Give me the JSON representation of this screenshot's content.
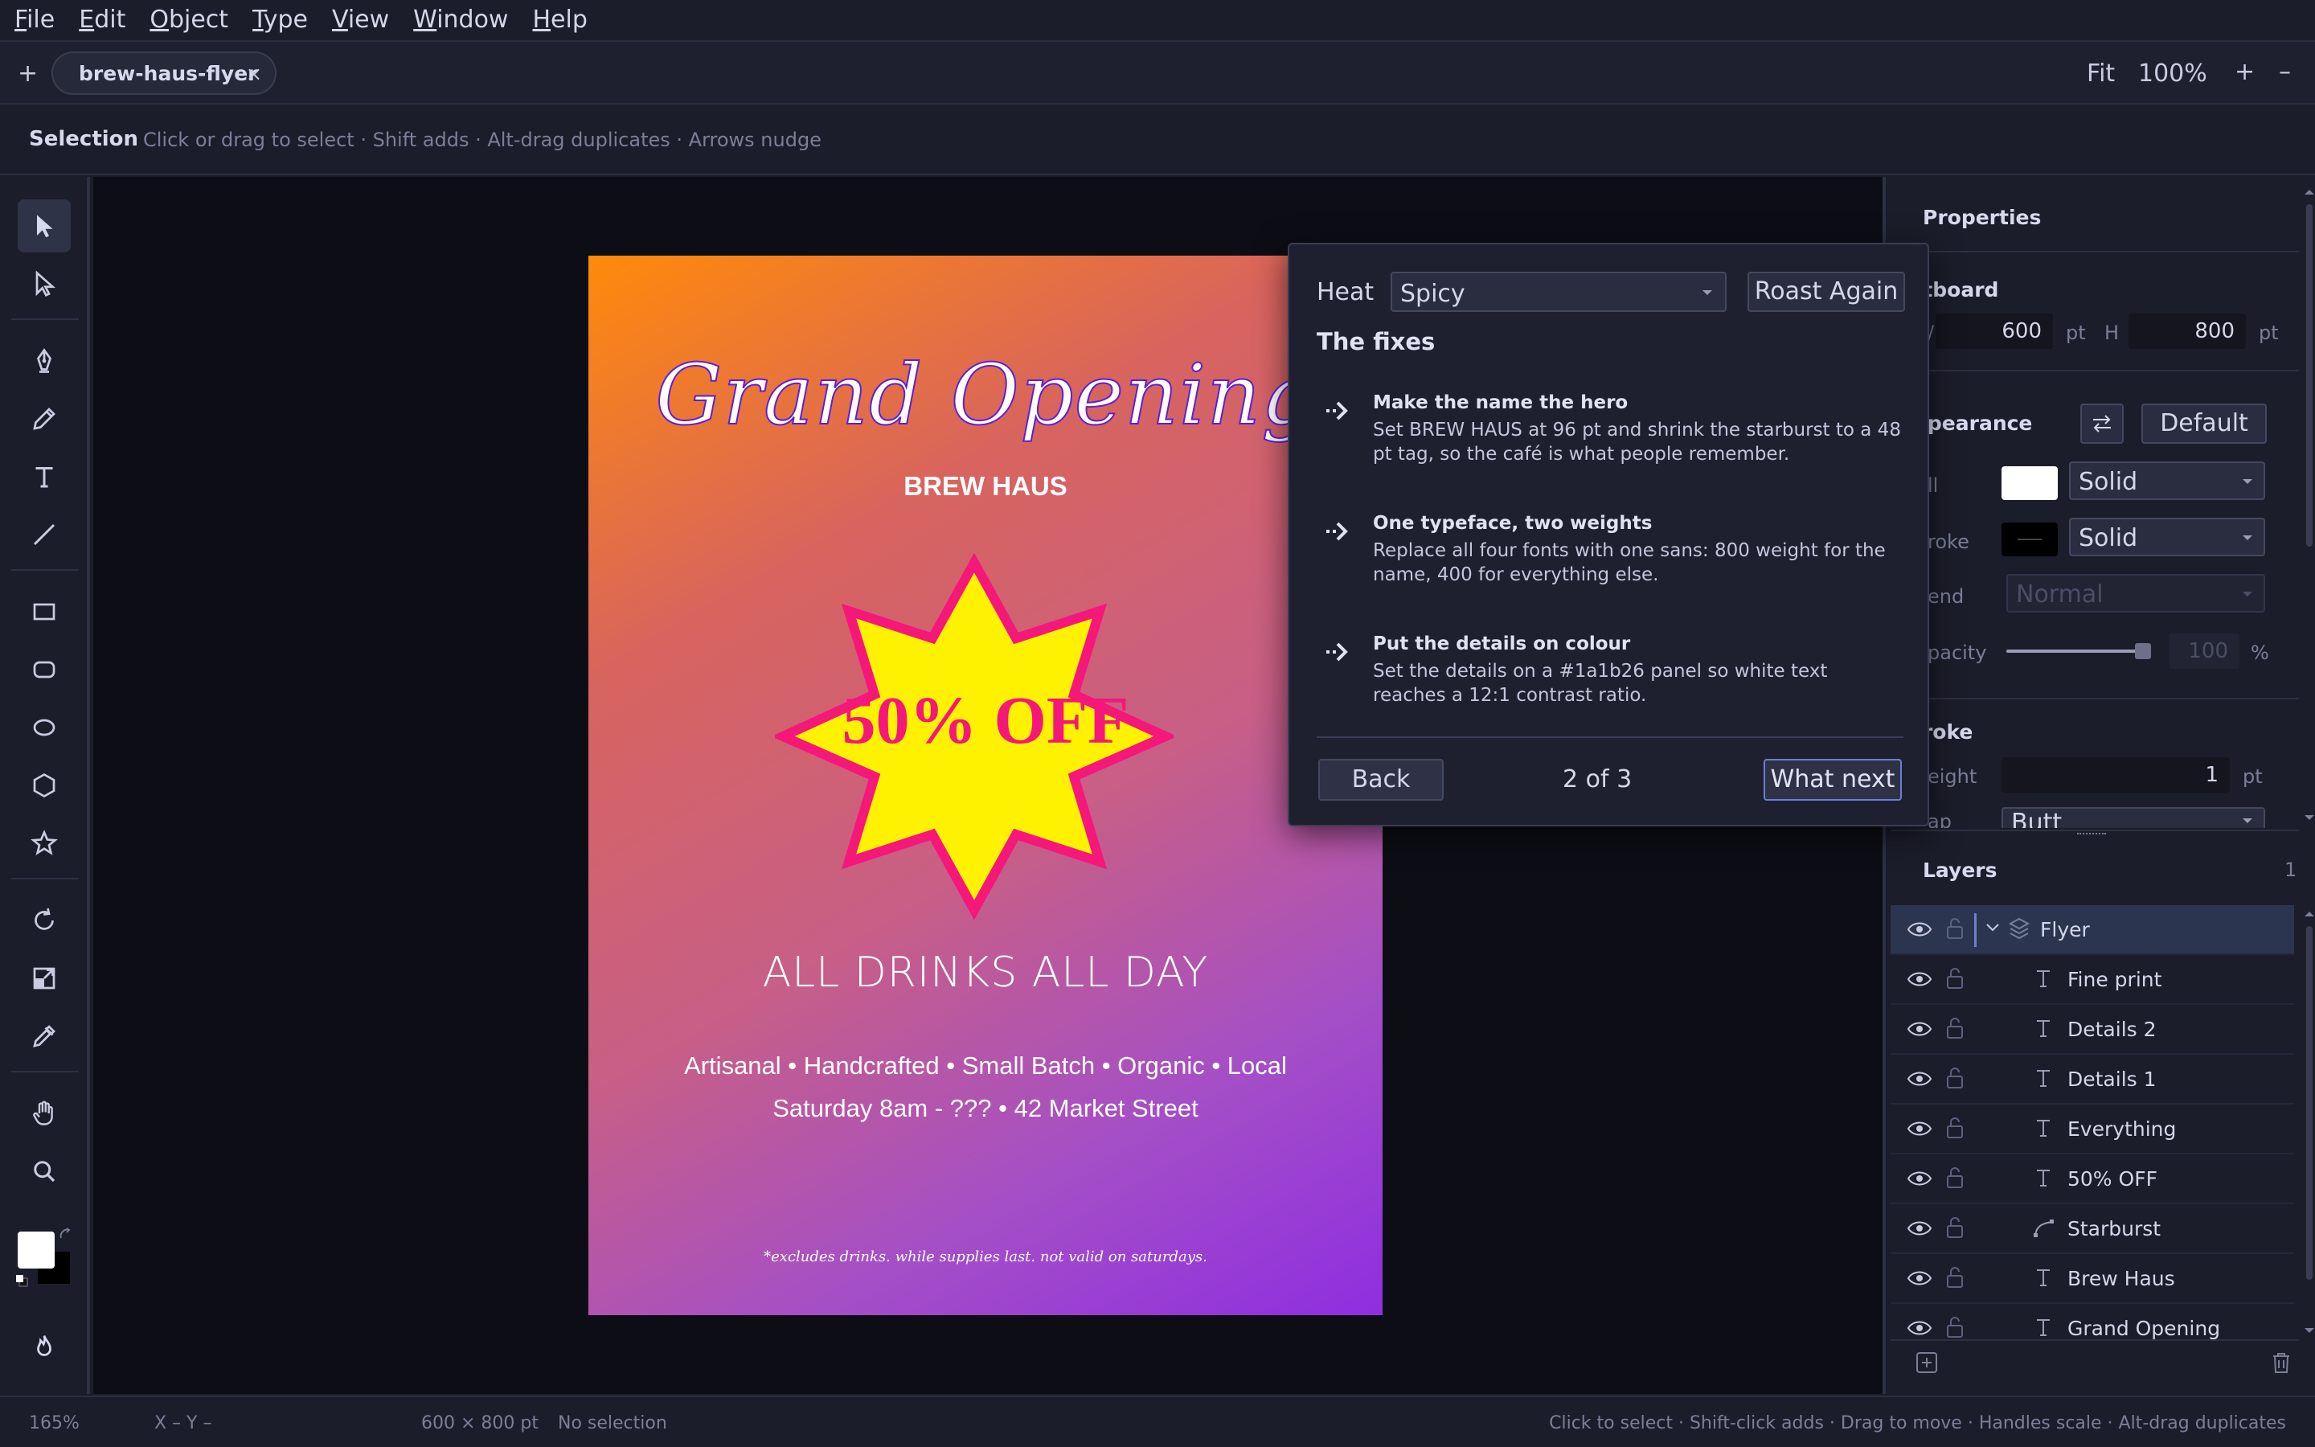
{
  "menu": [
    "File",
    "Edit",
    "Object",
    "Type",
    "View",
    "Window",
    "Help"
  ],
  "tabs": {
    "add_label": "+",
    "document": "brew-haus-flyer",
    "close_label": "×"
  },
  "zoom": {
    "fit_label": "Fit",
    "value": "100%",
    "in_label": "+",
    "out_label": "–"
  },
  "hint": {
    "tool": "Selection",
    "text": "Click or drag to select · Shift adds · Alt-drag duplicates · Arrows nudge"
  },
  "toolbar": {
    "tools": [
      "select-tool",
      "direct-select-tool",
      "pen-tool",
      "pencil-tool",
      "type-tool",
      "line-tool",
      "rectangle-tool",
      "rounded-rectangle-tool",
      "ellipse-tool",
      "polygon-tool",
      "star-tool",
      "rotate-tool",
      "scale-tool",
      "eyedropper-tool",
      "hand-tool",
      "zoom-tool",
      "roast-tool"
    ],
    "fill_color": "#ffffff",
    "stroke_color": "#000000"
  },
  "artboard": {
    "title": "Grand Opening",
    "brand": "BREW HAUS",
    "offer": "50% OFF",
    "headline": "ALL DRINKS ALL DAY",
    "details1": "Artisanal • Handcrafted • Small Batch • Organic • Local",
    "details2": "Saturday 8am - ??? • 42 Market Street",
    "fine_print": "*excludes drinks. while supplies last. not valid on saturdays.",
    "starburst_fill": "#fff200",
    "starburst_stroke": "#f5177a"
  },
  "roast": {
    "heat_label": "Heat",
    "heat_value": "Spicy",
    "roast_again": "Roast Again",
    "fixes_title": "The fixes",
    "fixes": [
      {
        "title": "Make the name the hero",
        "desc": "Set BREW HAUS at 96 pt and shrink the starburst to a 48 pt tag, so the café is what people remember."
      },
      {
        "title": "One typeface, two weights",
        "desc": "Replace all four fonts with one sans: 800 weight for the name, 400 for everything else."
      },
      {
        "title": "Put the details on colour",
        "desc": "Set the details on a #1a1b26 panel so white text reaches a 12:1 contrast ratio."
      }
    ],
    "back": "Back",
    "pager": "2 of 3",
    "next": "What next"
  },
  "properties": {
    "title": "Properties",
    "artboard_head": "rtboard",
    "w_label": "/",
    "w_value": "600",
    "h_label": "H",
    "h_value": "800",
    "unit": "pt",
    "appearance_head": "ppearance",
    "default_btn": "Default",
    "fill_label": "ll",
    "fill_type": "Solid",
    "stroke_label": "roke",
    "stroke_type": "Solid",
    "blend_label": "end",
    "blend_value": "Normal",
    "opacity_label": "pacity",
    "opacity_value": "100",
    "opacity_unit": "%",
    "opacity_level": 1.0,
    "stroke_head": "troke",
    "weight_label": "eight",
    "weight_value": "1",
    "cap_label": "ap",
    "cap_value": "Butt"
  },
  "layers": {
    "title": "Layers",
    "count": "1",
    "items": [
      {
        "name": "Flyer",
        "type": "group"
      },
      {
        "name": "Fine print",
        "type": "text"
      },
      {
        "name": "Details 2",
        "type": "text"
      },
      {
        "name": "Details 1",
        "type": "text"
      },
      {
        "name": "Everything",
        "type": "text"
      },
      {
        "name": "50% OFF",
        "type": "text"
      },
      {
        "name": "Starburst",
        "type": "path"
      },
      {
        "name": "Brew Haus",
        "type": "text"
      },
      {
        "name": "Grand Opening",
        "type": "text"
      }
    ]
  },
  "status": {
    "zoom": "165%",
    "coords": "X –  Y –",
    "size": "600 × 800 pt",
    "selection": "No selection",
    "help": "Click to select · Shift-click adds · Drag to move · Handles scale · Alt-drag duplicates"
  }
}
